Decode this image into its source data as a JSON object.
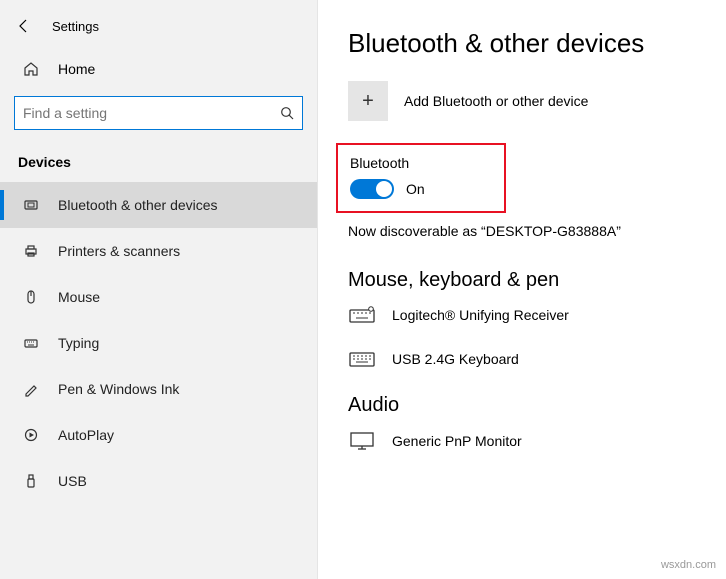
{
  "header": {
    "settings": "Settings"
  },
  "home": {
    "label": "Home"
  },
  "search": {
    "placeholder": "Find a setting"
  },
  "category": {
    "label": "Devices"
  },
  "nav": {
    "items": [
      {
        "label": "Bluetooth & other devices"
      },
      {
        "label": "Printers & scanners"
      },
      {
        "label": "Mouse"
      },
      {
        "label": "Typing"
      },
      {
        "label": "Pen & Windows Ink"
      },
      {
        "label": "AutoPlay"
      },
      {
        "label": "USB"
      }
    ]
  },
  "page": {
    "title": "Bluetooth & other devices",
    "add_label": "Add Bluetooth or other device",
    "bluetooth": {
      "heading": "Bluetooth",
      "state": "On"
    },
    "discoverable": "Now discoverable as “DESKTOP-G83888A”",
    "mkp_heading": "Mouse, keyboard & pen",
    "devices": [
      {
        "label": "Logitech® Unifying Receiver"
      },
      {
        "label": "USB 2.4G Keyboard"
      }
    ],
    "audio_heading": "Audio",
    "audio_devices": [
      {
        "label": "Generic PnP Monitor"
      }
    ]
  },
  "watermark": "wsxdn.com"
}
